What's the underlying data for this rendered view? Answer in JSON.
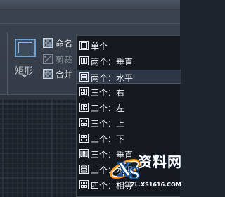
{
  "ribbon": {
    "rectangle_label": "矩形",
    "rename_label": "命名",
    "cut_label": "剪裁",
    "merge_label": "合并"
  },
  "menu": {
    "items": [
      {
        "label": "单个",
        "icon": "single-viewport-icon",
        "active": false
      },
      {
        "label": "两个：垂直",
        "icon": "two-vertical-icon",
        "active": false
      },
      {
        "label": "两个：水平",
        "icon": "two-horizontal-icon",
        "active": true
      },
      {
        "label": "三个：右",
        "icon": "three-right-icon",
        "active": false
      },
      {
        "label": "三个：左",
        "icon": "three-left-icon",
        "active": false
      },
      {
        "label": "三个：上",
        "icon": "three-above-icon",
        "active": false
      },
      {
        "label": "三个：下",
        "icon": "three-below-icon",
        "active": false
      },
      {
        "label": "三个：垂直",
        "icon": "three-vertical-icon",
        "active": false
      },
      {
        "label": "三个：水平",
        "icon": "three-horizontal-icon",
        "active": false
      },
      {
        "label": "四个：相等",
        "icon": "four-equal-icon",
        "active": false
      }
    ]
  },
  "watermark": {
    "main": "资料网",
    "sub": "ZL.XS1616.COM"
  }
}
